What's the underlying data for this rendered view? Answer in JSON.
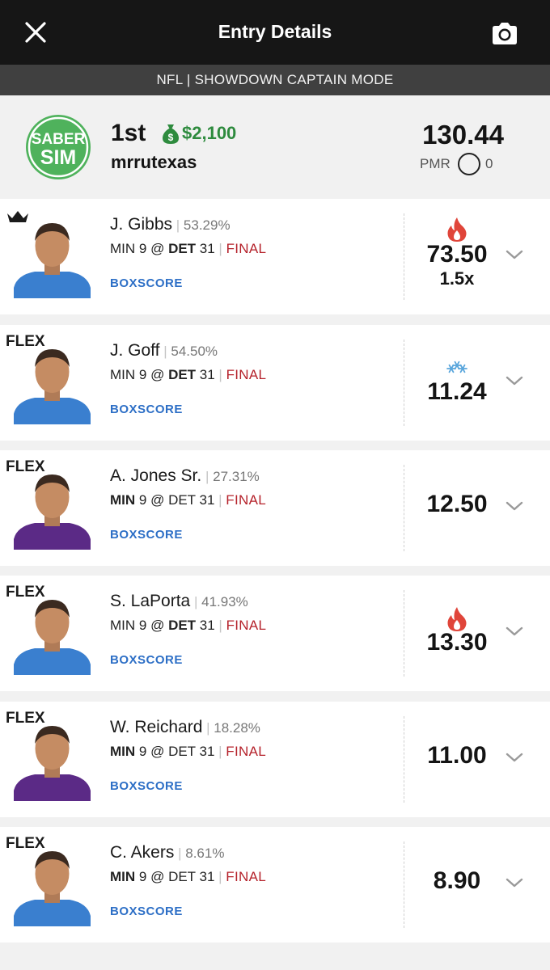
{
  "header": {
    "title": "Entry Details",
    "close_icon": "close-icon",
    "camera_icon": "camera-icon"
  },
  "contest": {
    "label": "NFL | SHOWDOWN CAPTAIN MODE"
  },
  "entry": {
    "logo_text_top": "SABER",
    "logo_text_bottom": "SIM",
    "logo_color": "#4fb25c",
    "rank": "1st",
    "prize": "$2,100",
    "prize_color": "#2e8b3e",
    "username": "mrrutexas",
    "total_points": "130.44",
    "pmr_label": "PMR",
    "pmr_value": "0"
  },
  "players": [
    {
      "slot": "captain",
      "slot_icon": "crown-icon",
      "name": "J. Gibbs",
      "ownership": "53.29%",
      "game": {
        "away": "MIN",
        "away_score": "9",
        "at": "@",
        "home": "DET",
        "home_score": "31",
        "status": "FINAL",
        "bold_team": "home"
      },
      "boxscore": "BOXSCORE",
      "points": "73.50",
      "multiplier": "1.5x",
      "indicator": "fire-icon",
      "jersey": "#3a7fcf"
    },
    {
      "slot": "FLEX",
      "name": "J. Goff",
      "ownership": "54.50%",
      "game": {
        "away": "MIN",
        "away_score": "9",
        "at": "@",
        "home": "DET",
        "home_score": "31",
        "status": "FINAL",
        "bold_team": "home"
      },
      "boxscore": "BOXSCORE",
      "points": "11.24",
      "multiplier": "",
      "indicator": "snowflake-icon",
      "jersey": "#3a7fcf"
    },
    {
      "slot": "FLEX",
      "name": "A. Jones Sr.",
      "ownership": "27.31%",
      "game": {
        "away": "MIN",
        "away_score": "9",
        "at": "@",
        "home": "DET",
        "home_score": "31",
        "status": "FINAL",
        "bold_team": "away"
      },
      "boxscore": "BOXSCORE",
      "points": "12.50",
      "multiplier": "",
      "indicator": "",
      "jersey": "#5b2a86"
    },
    {
      "slot": "FLEX",
      "name": "S. LaPorta",
      "ownership": "41.93%",
      "game": {
        "away": "MIN",
        "away_score": "9",
        "at": "@",
        "home": "DET",
        "home_score": "31",
        "status": "FINAL",
        "bold_team": "home"
      },
      "boxscore": "BOXSCORE",
      "points": "13.30",
      "multiplier": "",
      "indicator": "fire-icon",
      "jersey": "#3a7fcf"
    },
    {
      "slot": "FLEX",
      "name": "W. Reichard",
      "ownership": "18.28%",
      "game": {
        "away": "MIN",
        "away_score": "9",
        "at": "@",
        "home": "DET",
        "home_score": "31",
        "status": "FINAL",
        "bold_team": "away"
      },
      "boxscore": "BOXSCORE",
      "points": "11.00",
      "multiplier": "",
      "indicator": "",
      "jersey": "#5b2a86"
    },
    {
      "slot": "FLEX",
      "name": "C. Akers",
      "ownership": "8.61%",
      "game": {
        "away": "MIN",
        "away_score": "9",
        "at": "@",
        "home": "DET",
        "home_score": "31",
        "status": "FINAL",
        "bold_team": "away"
      },
      "boxscore": "BOXSCORE",
      "points": "8.90",
      "multiplier": "",
      "indicator": "",
      "jersey": "#3a7fcf"
    }
  ],
  "colors": {
    "fire": "#e0453a",
    "snow": "#5aa6dc",
    "final": "#b5222b",
    "boxscore": "#2d6fc6"
  }
}
